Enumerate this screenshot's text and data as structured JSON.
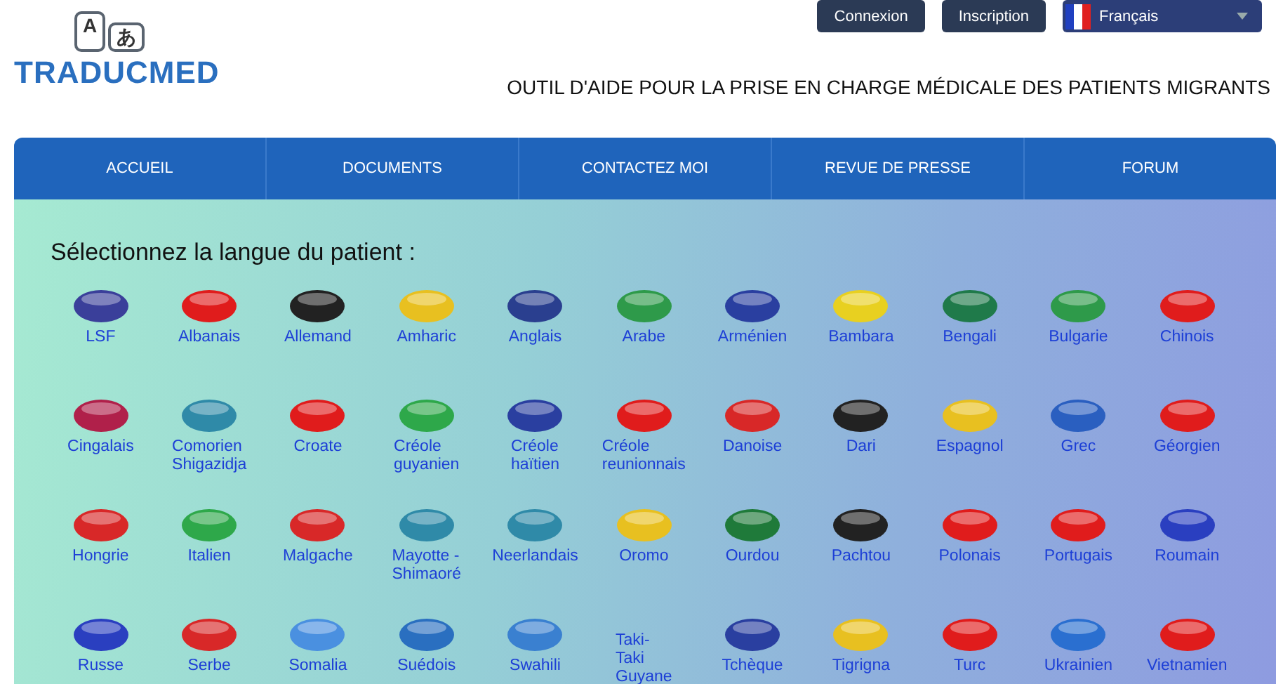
{
  "logo": {
    "bubble_left": "A",
    "bubble_right": "あ",
    "name": "TRADUCMED"
  },
  "auth_buttons": [
    "Connexion",
    "Inscription"
  ],
  "language_select": {
    "value": "Français"
  },
  "tagline": "OUTIL D'AIDE POUR LA PRISE EN CHARGE MÉDICALE DES PATIENTS MIGRANTS",
  "nav": [
    {
      "label": "ACCUEIL"
    },
    {
      "label": "DOCUMENTS"
    },
    {
      "label": "CONTACTEZ MOI"
    },
    {
      "label": "REVUE DE PRESSE"
    },
    {
      "label": "FORUM"
    }
  ],
  "heading": "Sélectionnez la langue du patient :",
  "languages": [
    {
      "label": "LSF",
      "color": "#3a3f9a"
    },
    {
      "label": "Albanais",
      "color": "#e01c1c"
    },
    {
      "label": "Allemand",
      "color": "#222222"
    },
    {
      "label": "Amharic",
      "color": "#e8c020"
    },
    {
      "label": "Anglais",
      "color": "#2a3f8f"
    },
    {
      "label": "Arabe",
      "color": "#2e9a4a"
    },
    {
      "label": "Arménien",
      "color": "#2a3fa0"
    },
    {
      "label": "Bambara",
      "color": "#e8d020"
    },
    {
      "label": "Bengali",
      "color": "#1f7a4a"
    },
    {
      "label": "Bulgarie",
      "color": "#2e9a4a"
    },
    {
      "label": "Chinois",
      "color": "#e01c1c"
    },
    {
      "label": "Cingalais",
      "color": "#b0204a"
    },
    {
      "label": "Comorien\nShigazidja",
      "color": "#2f8aa8"
    },
    {
      "label": "Croate",
      "color": "#e01c1c"
    },
    {
      "label": "Créole\nguyanien",
      "color": "#2ea84a"
    },
    {
      "label": "Créole\nhaïtien",
      "color": "#2a3fa0"
    },
    {
      "label": "Créole\nreunionnais",
      "color": "#e01c1c"
    },
    {
      "label": "Danoise",
      "color": "#d82828"
    },
    {
      "label": "Dari",
      "color": "#222222"
    },
    {
      "label": "Espagnol",
      "color": "#e8c020"
    },
    {
      "label": "Grec",
      "color": "#2a5fc0"
    },
    {
      "label": "Géorgien",
      "color": "#e01c1c"
    },
    {
      "label": "Hongrie",
      "color": "#d82828"
    },
    {
      "label": "Italien",
      "color": "#2ea84a"
    },
    {
      "label": "Malgache",
      "color": "#d82828"
    },
    {
      "label": "Mayotte -\nShimaoré",
      "color": "#2f8aa8"
    },
    {
      "label": "Neerlandais",
      "color": "#2f8aa8"
    },
    {
      "label": "Oromo",
      "color": "#e8c020"
    },
    {
      "label": "Ourdou",
      "color": "#1f7a3a"
    },
    {
      "label": "Pachtou",
      "color": "#222222"
    },
    {
      "label": "Polonais",
      "color": "#e01c1c"
    },
    {
      "label": "Portugais",
      "color": "#e01c1c"
    },
    {
      "label": "Roumain",
      "color": "#2a3fc0"
    },
    {
      "label": "Russe",
      "color": "#2a3fc0"
    },
    {
      "label": "Serbe",
      "color": "#d82828"
    },
    {
      "label": "Somalia",
      "color": "#4a90e0"
    },
    {
      "label": "Suédois",
      "color": "#2a6fc0"
    },
    {
      "label": "Swahili",
      "color": "#3a80d0"
    },
    {
      "label": "Taki-\nTaki\nGuyane"
    },
    {
      "label": "Tchèque",
      "color": "#2a3fa0"
    },
    {
      "label": "Tigrigna",
      "color": "#e8c020"
    },
    {
      "label": "Turc",
      "color": "#e01c1c"
    },
    {
      "label": "Ukrainien",
      "color": "#2a6fd0"
    },
    {
      "label": "Vietnamien",
      "color": "#e01c1c"
    }
  ]
}
